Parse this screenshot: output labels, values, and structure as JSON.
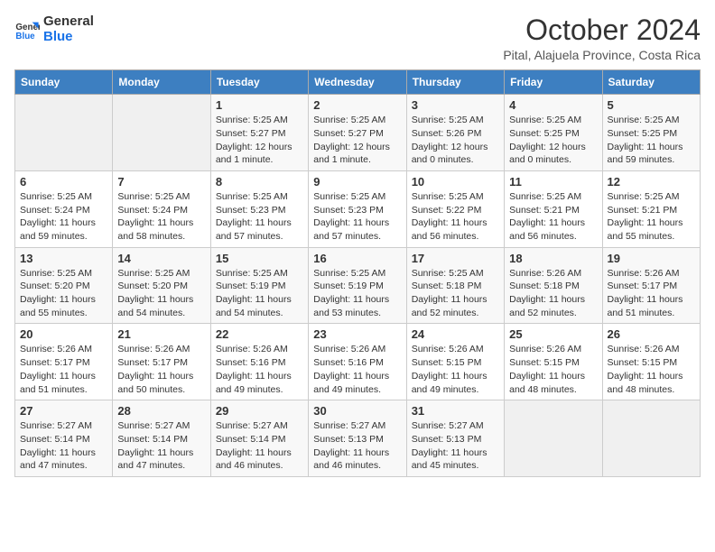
{
  "logo": {
    "line1": "General",
    "line2": "Blue"
  },
  "title": "October 2024",
  "subtitle": "Pital, Alajuela Province, Costa Rica",
  "weekdays": [
    "Sunday",
    "Monday",
    "Tuesday",
    "Wednesday",
    "Thursday",
    "Friday",
    "Saturday"
  ],
  "weeks": [
    [
      {
        "day": "",
        "info": ""
      },
      {
        "day": "",
        "info": ""
      },
      {
        "day": "1",
        "info": "Sunrise: 5:25 AM\nSunset: 5:27 PM\nDaylight: 12 hours\nand 1 minute."
      },
      {
        "day": "2",
        "info": "Sunrise: 5:25 AM\nSunset: 5:27 PM\nDaylight: 12 hours\nand 1 minute."
      },
      {
        "day": "3",
        "info": "Sunrise: 5:25 AM\nSunset: 5:26 PM\nDaylight: 12 hours\nand 0 minutes."
      },
      {
        "day": "4",
        "info": "Sunrise: 5:25 AM\nSunset: 5:25 PM\nDaylight: 12 hours\nand 0 minutes."
      },
      {
        "day": "5",
        "info": "Sunrise: 5:25 AM\nSunset: 5:25 PM\nDaylight: 11 hours\nand 59 minutes."
      }
    ],
    [
      {
        "day": "6",
        "info": "Sunrise: 5:25 AM\nSunset: 5:24 PM\nDaylight: 11 hours\nand 59 minutes."
      },
      {
        "day": "7",
        "info": "Sunrise: 5:25 AM\nSunset: 5:24 PM\nDaylight: 11 hours\nand 58 minutes."
      },
      {
        "day": "8",
        "info": "Sunrise: 5:25 AM\nSunset: 5:23 PM\nDaylight: 11 hours\nand 57 minutes."
      },
      {
        "day": "9",
        "info": "Sunrise: 5:25 AM\nSunset: 5:23 PM\nDaylight: 11 hours\nand 57 minutes."
      },
      {
        "day": "10",
        "info": "Sunrise: 5:25 AM\nSunset: 5:22 PM\nDaylight: 11 hours\nand 56 minutes."
      },
      {
        "day": "11",
        "info": "Sunrise: 5:25 AM\nSunset: 5:21 PM\nDaylight: 11 hours\nand 56 minutes."
      },
      {
        "day": "12",
        "info": "Sunrise: 5:25 AM\nSunset: 5:21 PM\nDaylight: 11 hours\nand 55 minutes."
      }
    ],
    [
      {
        "day": "13",
        "info": "Sunrise: 5:25 AM\nSunset: 5:20 PM\nDaylight: 11 hours\nand 55 minutes."
      },
      {
        "day": "14",
        "info": "Sunrise: 5:25 AM\nSunset: 5:20 PM\nDaylight: 11 hours\nand 54 minutes."
      },
      {
        "day": "15",
        "info": "Sunrise: 5:25 AM\nSunset: 5:19 PM\nDaylight: 11 hours\nand 54 minutes."
      },
      {
        "day": "16",
        "info": "Sunrise: 5:25 AM\nSunset: 5:19 PM\nDaylight: 11 hours\nand 53 minutes."
      },
      {
        "day": "17",
        "info": "Sunrise: 5:25 AM\nSunset: 5:18 PM\nDaylight: 11 hours\nand 52 minutes."
      },
      {
        "day": "18",
        "info": "Sunrise: 5:26 AM\nSunset: 5:18 PM\nDaylight: 11 hours\nand 52 minutes."
      },
      {
        "day": "19",
        "info": "Sunrise: 5:26 AM\nSunset: 5:17 PM\nDaylight: 11 hours\nand 51 minutes."
      }
    ],
    [
      {
        "day": "20",
        "info": "Sunrise: 5:26 AM\nSunset: 5:17 PM\nDaylight: 11 hours\nand 51 minutes."
      },
      {
        "day": "21",
        "info": "Sunrise: 5:26 AM\nSunset: 5:17 PM\nDaylight: 11 hours\nand 50 minutes."
      },
      {
        "day": "22",
        "info": "Sunrise: 5:26 AM\nSunset: 5:16 PM\nDaylight: 11 hours\nand 49 minutes."
      },
      {
        "day": "23",
        "info": "Sunrise: 5:26 AM\nSunset: 5:16 PM\nDaylight: 11 hours\nand 49 minutes."
      },
      {
        "day": "24",
        "info": "Sunrise: 5:26 AM\nSunset: 5:15 PM\nDaylight: 11 hours\nand 49 minutes."
      },
      {
        "day": "25",
        "info": "Sunrise: 5:26 AM\nSunset: 5:15 PM\nDaylight: 11 hours\nand 48 minutes."
      },
      {
        "day": "26",
        "info": "Sunrise: 5:26 AM\nSunset: 5:15 PM\nDaylight: 11 hours\nand 48 minutes."
      }
    ],
    [
      {
        "day": "27",
        "info": "Sunrise: 5:27 AM\nSunset: 5:14 PM\nDaylight: 11 hours\nand 47 minutes."
      },
      {
        "day": "28",
        "info": "Sunrise: 5:27 AM\nSunset: 5:14 PM\nDaylight: 11 hours\nand 47 minutes."
      },
      {
        "day": "29",
        "info": "Sunrise: 5:27 AM\nSunset: 5:14 PM\nDaylight: 11 hours\nand 46 minutes."
      },
      {
        "day": "30",
        "info": "Sunrise: 5:27 AM\nSunset: 5:13 PM\nDaylight: 11 hours\nand 46 minutes."
      },
      {
        "day": "31",
        "info": "Sunrise: 5:27 AM\nSunset: 5:13 PM\nDaylight: 11 hours\nand 45 minutes."
      },
      {
        "day": "",
        "info": ""
      },
      {
        "day": "",
        "info": ""
      }
    ]
  ]
}
